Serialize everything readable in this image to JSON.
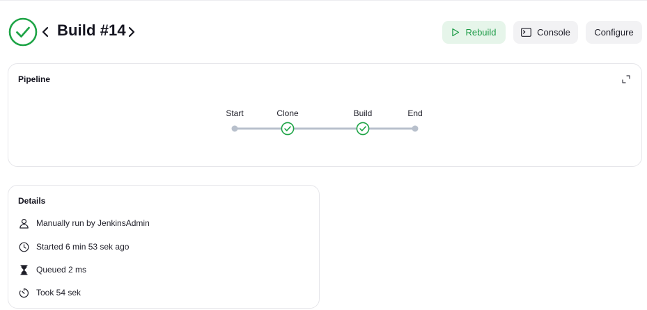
{
  "header": {
    "title": "Build #14",
    "status": "success",
    "status_color": "#1ea446"
  },
  "actions": {
    "rebuild_label": "Rebuild",
    "console_label": "Console",
    "configure_label": "Configure"
  },
  "pipeline": {
    "title": "Pipeline",
    "stages": [
      {
        "label": "Start",
        "kind": "terminal"
      },
      {
        "label": "Clone",
        "kind": "success"
      },
      {
        "label": "Build",
        "kind": "success"
      },
      {
        "label": "End",
        "kind": "terminal"
      }
    ]
  },
  "details": {
    "title": "Details",
    "rows": [
      {
        "icon": "user-icon",
        "prefix": "Manually run by ",
        "link": "JenkinsAdmin"
      },
      {
        "icon": "clock-icon",
        "text": "Started 6 min 53 sek ago"
      },
      {
        "icon": "hourglass-icon",
        "text": "Queued 2 ms"
      },
      {
        "icon": "timer-icon",
        "text": "Took 54 sek"
      }
    ]
  },
  "colors": {
    "accent_green": "#1ea446",
    "rebuild_bg": "#e6f5ea",
    "button_bg": "#f2f2f4",
    "track": "#b8c0cc"
  }
}
